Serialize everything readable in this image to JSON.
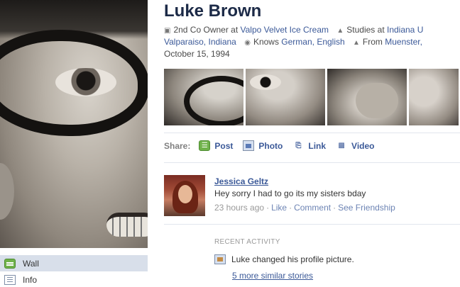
{
  "profile": {
    "name": "Luke Brown",
    "info_line1": {
      "work_prefix": "2nd Co Owner at ",
      "work_place": "Valpo Velvet Ice Cream",
      "study_prefix": "Studies at ",
      "study_place": "Indiana U"
    },
    "info_line2": {
      "city": "Valparaiso, Indiana",
      "languages_prefix": "Knows ",
      "languages": "German, English",
      "from_prefix": "From ",
      "from_place": "Muenster,"
    },
    "info_line3": {
      "birthday": "October 15, 1994"
    }
  },
  "sidebar": {
    "items": [
      {
        "label": "Wall",
        "icon": "wall-icon",
        "active": true
      },
      {
        "label": "Info",
        "icon": "info-icon",
        "active": false
      }
    ]
  },
  "share": {
    "label": "Share:",
    "items": [
      {
        "label": "Post",
        "icon": "post-icon"
      },
      {
        "label": "Photo",
        "icon": "photo-icon"
      },
      {
        "label": "Link",
        "icon": "link-icon"
      },
      {
        "label": "Video",
        "icon": "video-icon"
      }
    ]
  },
  "story": {
    "author": "Jessica Geltz",
    "text": "Hey sorry I had to go its my sisters bday",
    "time": "23 hours ago",
    "actions": [
      "Like",
      "Comment",
      "See Friendship"
    ]
  },
  "recent_activity": {
    "header": "Recent Activity",
    "item_text": "Luke changed his profile picture.",
    "more": "5 more similar stories"
  },
  "colors": {
    "link": "#3b5998",
    "name": "#1c2a47",
    "active_nav": "#d8dfea",
    "meta": "#999999"
  }
}
